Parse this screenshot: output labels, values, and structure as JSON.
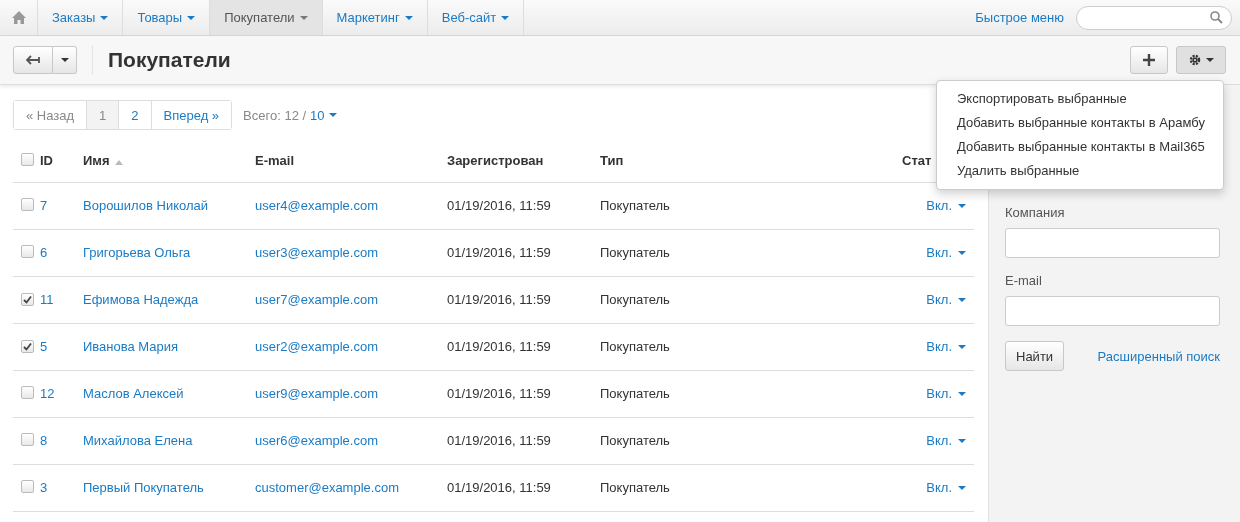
{
  "nav": {
    "items": [
      {
        "label": "Заказы",
        "selected": false
      },
      {
        "label": "Товары",
        "selected": false
      },
      {
        "label": "Покупатели",
        "selected": true
      },
      {
        "label": "Маркетинг",
        "selected": false
      },
      {
        "label": "Веб-сайт",
        "selected": false
      }
    ],
    "quick_menu": "Быстрое меню"
  },
  "title": "Покупатели",
  "actions_menu": [
    "Экспортировать выбранные",
    "Добавить выбранные контакты в Арамбу",
    "Добавить выбранные контакты в Mail365",
    "Удалить выбранные"
  ],
  "pagination": {
    "prev": "« Назад",
    "pages": [
      {
        "label": "1",
        "selected": true
      },
      {
        "label": "2",
        "selected": false
      }
    ],
    "next": "Вперед »",
    "total_label": "Всего: 12 /",
    "per_page": "10"
  },
  "table": {
    "select_all": {
      "checked": false
    },
    "columns": [
      "ID",
      "Имя",
      "E-mail",
      "Зарегистрован",
      "Тип",
      "Стат"
    ],
    "rows": [
      {
        "checked": false,
        "id": "7",
        "name": "Ворошилов Николай",
        "email": "user4@example.com",
        "registered": "01/19/2016, 11:59",
        "type": "Покупатель",
        "status": "Вкл."
      },
      {
        "checked": false,
        "id": "6",
        "name": "Григорьева Ольга",
        "email": "user3@example.com",
        "registered": "01/19/2016, 11:59",
        "type": "Покупатель",
        "status": "Вкл."
      },
      {
        "checked": true,
        "id": "11",
        "name": "Ефимова Надежда",
        "email": "user7@example.com",
        "registered": "01/19/2016, 11:59",
        "type": "Покупатель",
        "status": "Вкл."
      },
      {
        "checked": true,
        "id": "5",
        "name": "Иванова Мария",
        "email": "user2@example.com",
        "registered": "01/19/2016, 11:59",
        "type": "Покупатель",
        "status": "Вкл."
      },
      {
        "checked": false,
        "id": "12",
        "name": "Маслов Алексей",
        "email": "user9@example.com",
        "registered": "01/19/2016, 11:59",
        "type": "Покупатель",
        "status": "Вкл."
      },
      {
        "checked": false,
        "id": "8",
        "name": "Михайлова Елена",
        "email": "user6@example.com",
        "registered": "01/19/2016, 11:59",
        "type": "Покупатель",
        "status": "Вкл."
      },
      {
        "checked": false,
        "id": "3",
        "name": "Первый Покупатель",
        "email": "customer@example.com",
        "registered": "01/19/2016, 11:59",
        "type": "Покупатель",
        "status": "Вкл."
      }
    ]
  },
  "search_panel": {
    "fields": [
      "Компания",
      "E-mail"
    ],
    "button": "Найти",
    "advanced_link": "Расширенный поиск"
  }
}
